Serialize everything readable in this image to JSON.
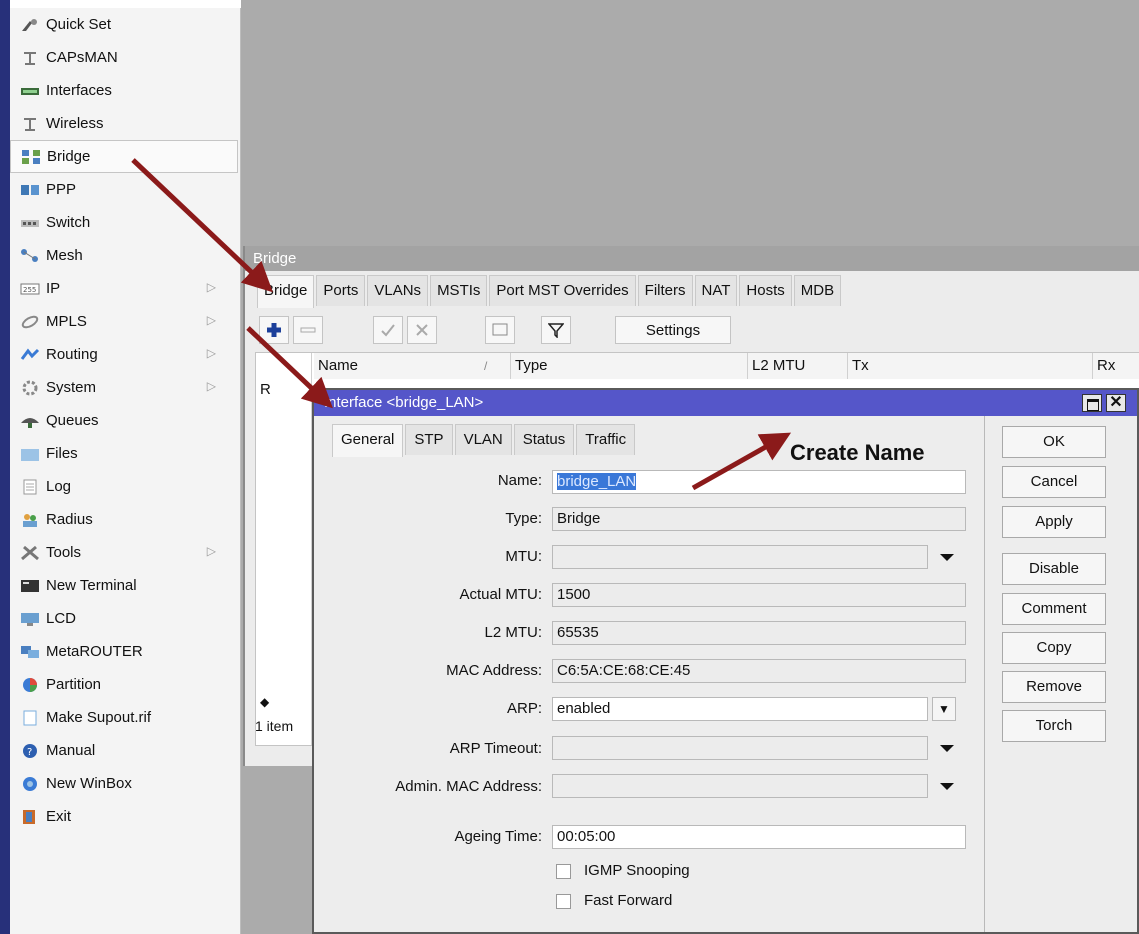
{
  "sidebar": {
    "items": [
      {
        "label": "Quick Set",
        "icon": "quick-set-icon",
        "submenu": false
      },
      {
        "label": "CAPsMAN",
        "icon": "antenna-icon",
        "submenu": false
      },
      {
        "label": "Interfaces",
        "icon": "interfaces-icon",
        "submenu": false
      },
      {
        "label": "Wireless",
        "icon": "antenna-icon",
        "submenu": false
      },
      {
        "label": "Bridge",
        "icon": "bridge-icon",
        "submenu": false
      },
      {
        "label": "PPP",
        "icon": "ppp-icon",
        "submenu": false
      },
      {
        "label": "Switch",
        "icon": "switch-icon",
        "submenu": false
      },
      {
        "label": "Mesh",
        "icon": "mesh-icon",
        "submenu": false
      },
      {
        "label": "IP",
        "icon": "ip-icon",
        "submenu": true
      },
      {
        "label": "MPLS",
        "icon": "mpls-icon",
        "submenu": true
      },
      {
        "label": "Routing",
        "icon": "routing-icon",
        "submenu": true
      },
      {
        "label": "System",
        "icon": "system-gear-icon",
        "submenu": true
      },
      {
        "label": "Queues",
        "icon": "queues-icon",
        "submenu": false
      },
      {
        "label": "Files",
        "icon": "folder-icon",
        "submenu": false
      },
      {
        "label": "Log",
        "icon": "log-icon",
        "submenu": false
      },
      {
        "label": "Radius",
        "icon": "radius-users-icon",
        "submenu": false
      },
      {
        "label": "Tools",
        "icon": "tools-icon",
        "submenu": true
      },
      {
        "label": "New Terminal",
        "icon": "terminal-icon",
        "submenu": false
      },
      {
        "label": "LCD",
        "icon": "lcd-icon",
        "submenu": false
      },
      {
        "label": "MetaROUTER",
        "icon": "metarouter-icon",
        "submenu": false
      },
      {
        "label": "Partition",
        "icon": "pie-icon",
        "submenu": false
      },
      {
        "label": "Make Supout.rif",
        "icon": "document-icon",
        "submenu": false
      },
      {
        "label": "Manual",
        "icon": "help-icon",
        "submenu": false
      },
      {
        "label": "New WinBox",
        "icon": "winbox-icon",
        "submenu": false
      },
      {
        "label": "Exit",
        "icon": "exit-icon",
        "submenu": false
      }
    ],
    "submenu_glyph": "▷"
  },
  "bridge_window": {
    "title": "Bridge",
    "tabs": [
      "Bridge",
      "Ports",
      "VLANs",
      "MSTIs",
      "Port MST Overrides",
      "Filters",
      "NAT",
      "Hosts",
      "MDB"
    ],
    "settings_label": "Settings",
    "columns": [
      "Name",
      "Type",
      "L2 MTU",
      "Tx",
      "Rx"
    ],
    "row_flag": "R",
    "status": "1 item",
    "sort_glyph": "/"
  },
  "dialog": {
    "title": "Interface <bridge_LAN>",
    "tabs": [
      "General",
      "STP",
      "VLAN",
      "Status",
      "Traffic"
    ],
    "fields": {
      "name": {
        "label": "Name:",
        "value": "bridge_LAN"
      },
      "type": {
        "label": "Type:",
        "value": "Bridge"
      },
      "mtu": {
        "label": "MTU:",
        "value": ""
      },
      "actual_mtu": {
        "label": "Actual MTU:",
        "value": "1500"
      },
      "l2_mtu": {
        "label": "L2 MTU:",
        "value": "65535"
      },
      "mac": {
        "label": "MAC Address:",
        "value": "C6:5A:CE:68:CE:45"
      },
      "arp": {
        "label": "ARP:",
        "value": "enabled"
      },
      "arp_timeout": {
        "label": "ARP Timeout:",
        "value": ""
      },
      "admin_mac": {
        "label": "Admin. MAC Address:",
        "value": ""
      },
      "ageing": {
        "label": "Ageing Time:",
        "value": "00:05:00"
      }
    },
    "checkboxes": {
      "igmp": {
        "label": "IGMP Snooping",
        "checked": false
      },
      "fast_forward": {
        "label": "Fast Forward",
        "checked": false
      }
    },
    "buttons": {
      "ok": "OK",
      "cancel": "Cancel",
      "apply": "Apply",
      "disable": "Disable",
      "comment": "Comment",
      "copy": "Copy",
      "remove": "Remove",
      "torch": "Torch"
    }
  },
  "annotation": {
    "text": "Create Name"
  },
  "colors": {
    "dialog_title": "#5556c9",
    "arrow": "#8b1a1a",
    "strip": "#27307a",
    "desktop": "#ababab"
  }
}
